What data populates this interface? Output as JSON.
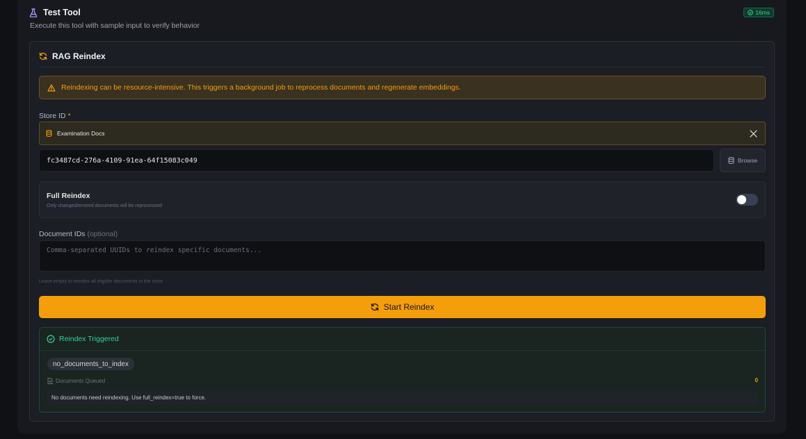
{
  "header": {
    "title": "Test Tool",
    "subtitle": "Execute this tool with sample input to verify behavior",
    "timing_badge": "16ms",
    "icon": "flask-icon"
  },
  "card": {
    "title": "RAG Reindex",
    "icon": "refresh-icon",
    "warning": "Reindexing can be resource-intensive. This triggers a background job to reprocess documents and regenerate embeddings."
  },
  "store": {
    "label": "Store ID",
    "required_mark": "*",
    "selected_name": "Examination Docs",
    "id_value": "fc3487cd-276a-4109-91ea-64f15083c049",
    "browse_label": "Browse"
  },
  "full_reindex": {
    "label": "Full Reindex",
    "description": "Only changed/errored documents will be reprocessed",
    "enabled": false
  },
  "document_ids": {
    "label": "Document IDs",
    "optional_mark": "(optional)",
    "placeholder": "Comma-separated UUIDs to reindex specific documents...",
    "hint": "Leave empty to reindex all eligible documents in the store"
  },
  "start_button": {
    "label": "Start Reindex"
  },
  "result": {
    "title": "Reindex Triggered",
    "status_pill": "no_documents_to_index",
    "queued_label": "Documents Queued",
    "queued_value": "0",
    "message": "No documents need reindexing. Use full_reindex=true to force."
  },
  "colors": {
    "accent": "#f59e0b",
    "success": "#34d399",
    "background": "#0f1115",
    "header_icon": "#a78bfa"
  }
}
